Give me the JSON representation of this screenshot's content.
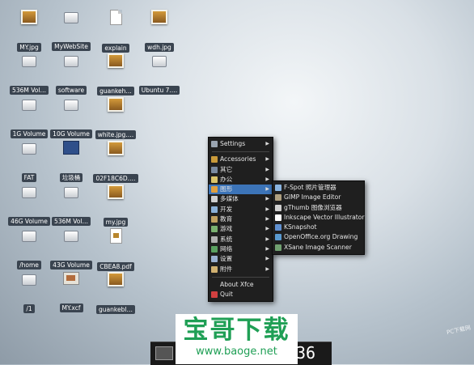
{
  "desktop": {
    "icons": [
      {
        "label": "MY.jpg",
        "type": "image"
      },
      {
        "label": "MyWebSite",
        "type": "drive"
      },
      {
        "label": "explain",
        "type": "document"
      },
      {
        "label": "wdh.jpg",
        "type": "image"
      },
      {
        "label": "536M Vol…",
        "type": "drive"
      },
      {
        "label": "software",
        "type": "drive"
      },
      {
        "label": "guankeh…",
        "type": "image"
      },
      {
        "label": "Ubuntu 7.…",
        "type": "drive"
      },
      {
        "label": "1G Volume",
        "type": "drive"
      },
      {
        "label": "10G Volume",
        "type": "drive"
      },
      {
        "label": "white.jpg.…",
        "type": "image"
      },
      {
        "label": "FAT",
        "type": "drive"
      },
      {
        "label": "垃圾桶",
        "type": "folder"
      },
      {
        "label": "02F18C6D.…",
        "type": "image"
      },
      {
        "label": "46G Volume",
        "type": "drive"
      },
      {
        "label": "536M Vol…",
        "type": "drive"
      },
      {
        "label": "my.jpg",
        "type": "image"
      },
      {
        "label": "/home",
        "type": "drive"
      },
      {
        "label": "43G Volume",
        "type": "drive"
      },
      {
        "label": "CBEA8.pdf",
        "type": "pdf"
      },
      {
        "label": "/1",
        "type": "drive"
      },
      {
        "label": "MY.xcf",
        "type": "xcf"
      },
      {
        "label": "guankebl…",
        "type": "image"
      }
    ]
  },
  "main_menu": {
    "items": [
      {
        "label": "Settings",
        "submenu": true,
        "icon": "settings-icon",
        "color": "#9aa4b0"
      },
      {
        "separator": true
      },
      {
        "label": "Accessories",
        "submenu": true,
        "icon": "accessories-icon",
        "color": "#c99a3a"
      },
      {
        "label": "其它",
        "submenu": true,
        "icon": "other-icon",
        "color": "#7a8aa0"
      },
      {
        "label": "办公",
        "submenu": true,
        "icon": "office-icon",
        "color": "#d9c36a"
      },
      {
        "label": "图形",
        "submenu": true,
        "icon": "graphics-icon",
        "color": "#e0a040",
        "active": true
      },
      {
        "label": "多媒体",
        "submenu": true,
        "icon": "multimedia-icon",
        "color": "#cfcfcf"
      },
      {
        "label": "开发",
        "submenu": true,
        "icon": "development-icon",
        "color": "#8ab0d8"
      },
      {
        "label": "教育",
        "submenu": true,
        "icon": "education-icon",
        "color": "#c0a060"
      },
      {
        "label": "游戏",
        "submenu": true,
        "icon": "games-icon",
        "color": "#7ab070"
      },
      {
        "label": "系统",
        "submenu": true,
        "icon": "system-icon",
        "color": "#b0b0b0"
      },
      {
        "label": "网络",
        "submenu": true,
        "icon": "network-icon",
        "color": "#5aa060"
      },
      {
        "label": "设置",
        "submenu": true,
        "icon": "preferences-icon",
        "color": "#9ab0d0"
      },
      {
        "label": "附件",
        "submenu": true,
        "icon": "attachments-icon",
        "color": "#d0b070"
      },
      {
        "separator": true
      },
      {
        "label": "About Xfce",
        "submenu": false,
        "icon": "",
        "color": ""
      },
      {
        "label": "Quit",
        "submenu": false,
        "icon": "quit-icon",
        "color": "#d04040"
      }
    ]
  },
  "graphics_submenu": {
    "items": [
      {
        "label": "F-Spot 照片管理器",
        "icon": "fspot-icon",
        "color": "#8ab4e0"
      },
      {
        "label": "GIMP Image Editor",
        "icon": "gimp-icon",
        "color": "#b0a080"
      },
      {
        "label": "gThumb 图像浏览器",
        "icon": "gthumb-icon",
        "color": "#d0d0d0"
      },
      {
        "label": "Inkscape Vector Illustrator",
        "icon": "inkscape-icon",
        "color": "#ffffff"
      },
      {
        "label": "KSnapshot",
        "icon": "ksnapshot-icon",
        "color": "#6090d0"
      },
      {
        "label": "OpenOffice.org Drawing",
        "icon": "openoffice-draw-icon",
        "color": "#5a9ad0"
      },
      {
        "label": "XSane Image Scanner",
        "icon": "xsane-icon",
        "color": "#70a070"
      }
    ]
  },
  "watermark": {
    "title": "宝哥下载",
    "url": "www.baoge.net"
  },
  "clock": {
    "time": "36"
  },
  "corner_text": "PC下载网"
}
